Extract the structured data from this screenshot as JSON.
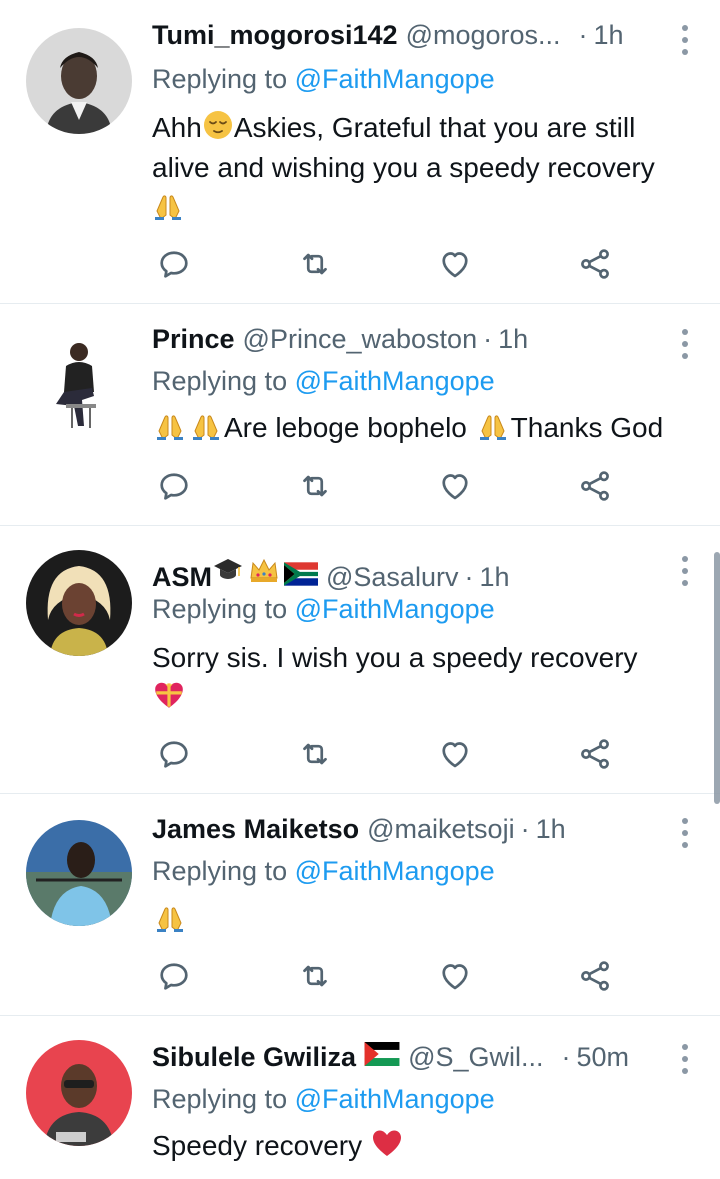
{
  "colors": {
    "link": "#1d9bf0",
    "secondary_text": "#536471",
    "primary_text": "#0f1419",
    "divider": "#e6ecf0"
  },
  "replying_prefix": "Replying to",
  "replying_target": "@FaithMangope",
  "tweets": [
    {
      "name": "Tumi_mogorosi142",
      "handle": "@mogoros...",
      "separator": "·",
      "time": "1h",
      "text": "Ahh",
      "text_after_emoji": "Askies, Grateful that you are still alive and wishing you a speedy recovery",
      "emojis": [
        "relieved-face-emoji",
        "folded-hands-emoji"
      ]
    },
    {
      "name": "Prince",
      "handle": "@Prince_waboston",
      "separator": "·",
      "time": "1h",
      "text_a": "Are leboge bophelo",
      "text_b": "Thanks God",
      "emojis": [
        "folded-hands-emoji",
        "folded-hands-emoji",
        "folded-hands-emoji"
      ]
    },
    {
      "name": "ASM",
      "handle": "@Sasalurv",
      "separator": "·",
      "time": "1h",
      "text": "Sorry sis. I wish you a speedy recovery",
      "emojis": [
        "graduation-cap-emoji",
        "crown-emoji",
        "south-africa-flag-emoji",
        "heart-with-ribbon-emoji"
      ]
    },
    {
      "name": "James Maiketso",
      "handle": "@maiketsoji",
      "separator": "·",
      "time": "1h",
      "text": "",
      "emojis": [
        "folded-hands-emoji"
      ]
    },
    {
      "name": "Sibulele Gwiliza",
      "handle": "@S_Gwil...",
      "separator": "·",
      "time": "50m",
      "text": "Speedy recovery",
      "emojis": [
        "palestine-flag-emoji",
        "red-heart-emoji"
      ]
    }
  ],
  "action_icons": [
    "reply-icon",
    "retweet-icon",
    "like-icon",
    "share-icon"
  ]
}
